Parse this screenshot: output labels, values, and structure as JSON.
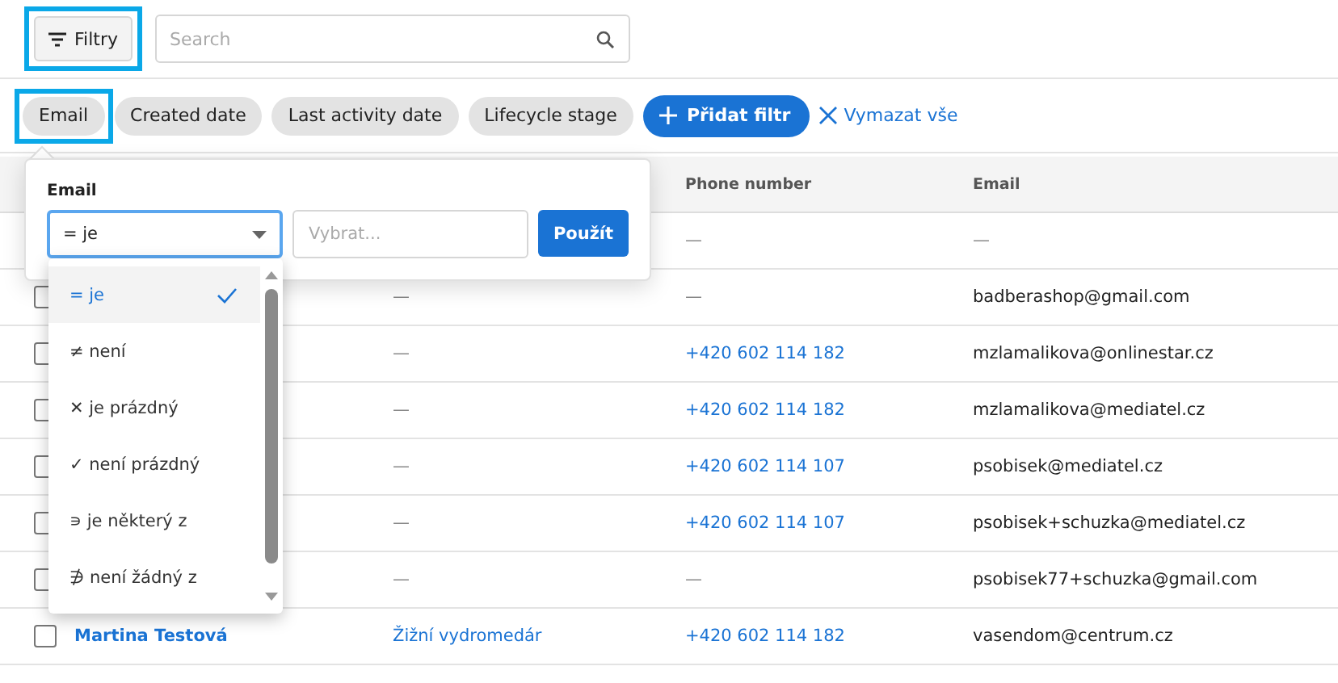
{
  "toolbar": {
    "filter_button": {
      "label": "Filtry",
      "highlighted": true
    },
    "search": {
      "placeholder": "Search"
    }
  },
  "filter_chips": [
    {
      "label": "Email",
      "highlighted": true
    },
    {
      "label": "Created date",
      "highlighted": false
    },
    {
      "label": "Last activity date",
      "highlighted": false
    },
    {
      "label": "Lifecycle stage",
      "highlighted": false
    }
  ],
  "add_filter": "Přidat filtr",
  "clear_all": "Vymazat vše",
  "popover": {
    "title": "Email",
    "operator": "= je",
    "value_placeholder": "Vybrat...",
    "apply": "Použít",
    "options": [
      {
        "label": "= je",
        "selected": true
      },
      {
        "label": "≠ není",
        "selected": false
      },
      {
        "label": "✕ je prázdný",
        "selected": false
      },
      {
        "label": "✓ není prázdný",
        "selected": false
      },
      {
        "label": "∍ je některý z",
        "selected": false
      },
      {
        "label": "∌ není žádný z",
        "selected": false
      }
    ]
  },
  "table": {
    "columns": [
      "Phone number",
      "Email"
    ],
    "rows": [
      {
        "phone": "—",
        "email": "—"
      },
      {
        "checked": false,
        "company": "—",
        "phone": "—",
        "email": "badberashop@gmail.com"
      },
      {
        "checked": false,
        "company": "—",
        "phone": "+420 602 114 182",
        "email": "mzlamalikova@onlinestar.cz"
      },
      {
        "checked": false,
        "company": "—",
        "phone": "+420 602 114 182",
        "email": "mzlamalikova@mediatel.cz"
      },
      {
        "checked": false,
        "company": "—",
        "phone": "+420 602 114 107",
        "email": "psobisek@mediatel.cz"
      },
      {
        "checked": false,
        "company": "—",
        "phone": "+420 602 114 107",
        "email": "psobisek+schuzka@mediatel.cz"
      },
      {
        "checked": false,
        "company": "—",
        "phone": "—",
        "email": "psobisek77+schuzka@gmail.com"
      },
      {
        "checked": false,
        "name": "Martina Testová",
        "company": "Žižní vydromedár",
        "phone": "+420 602 114 182",
        "email": "vasendom@centrum.cz"
      }
    ]
  }
}
